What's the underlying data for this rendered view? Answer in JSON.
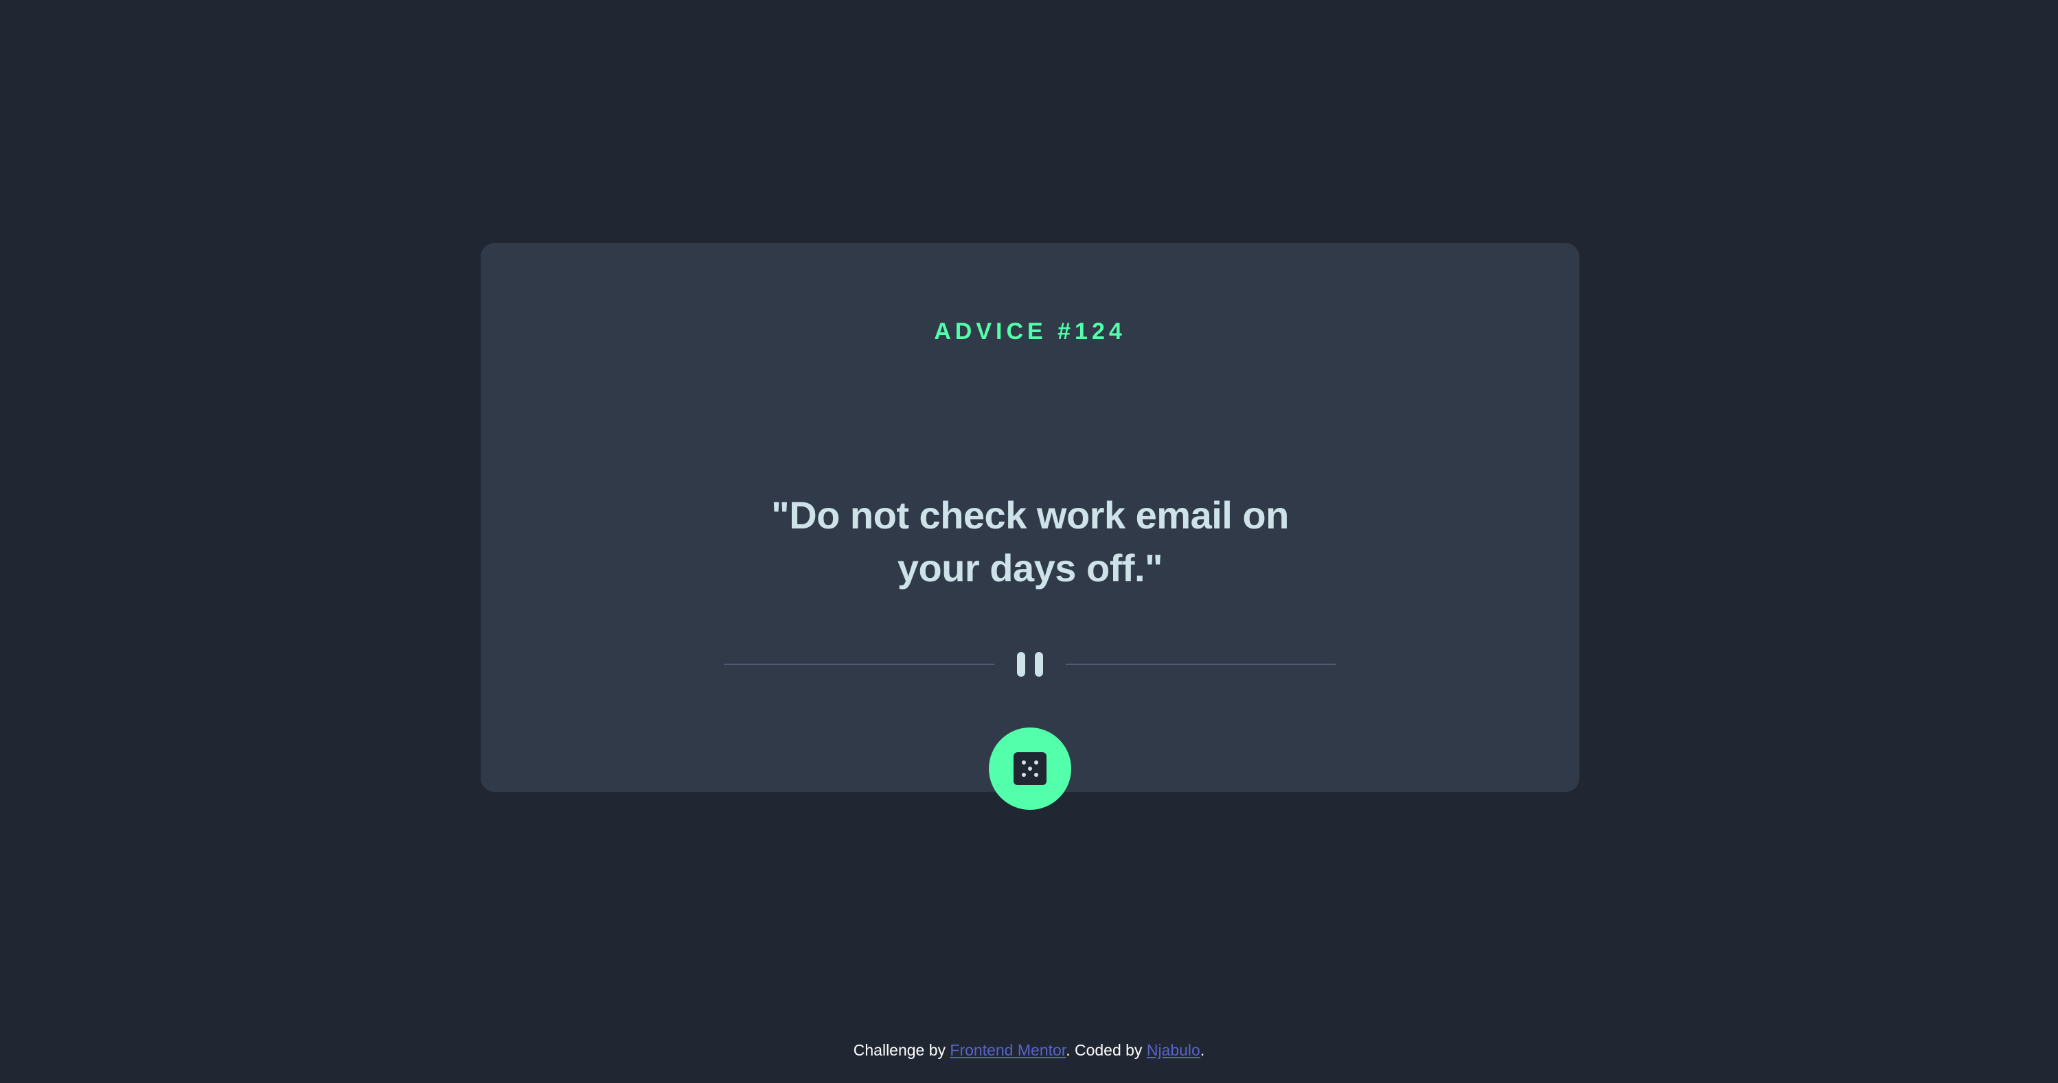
{
  "card": {
    "advice_id": "ADVICE #124",
    "quote": "\"Do not check work email on your days off.\""
  },
  "dice_button": {
    "icon": "dice-icon"
  },
  "footer": {
    "prefix": "Challenge by ",
    "challenge_link": "Frontend Mentor",
    "middle": ". Coded by ",
    "author_link": "Njabulo",
    "suffix": "."
  },
  "colors": {
    "background": "#202632",
    "card": "#313a48",
    "accent": "#53ffaa",
    "quote_text": "#cee3e9",
    "divider": "#4f5d74",
    "link": "#5864c8"
  }
}
